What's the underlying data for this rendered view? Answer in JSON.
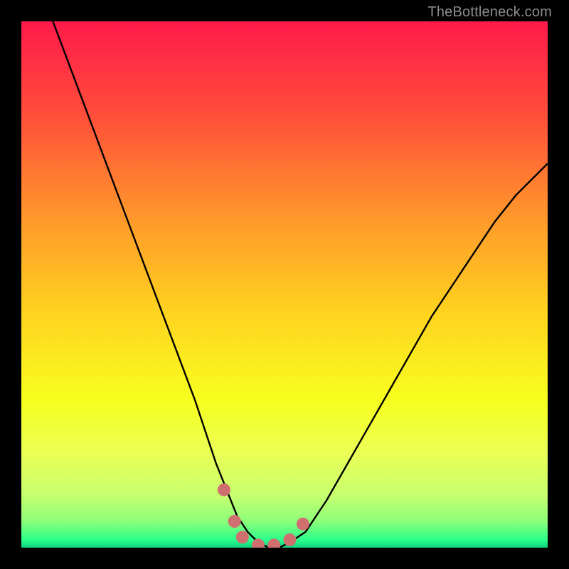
{
  "watermark": {
    "text": "TheBottleneck.com"
  },
  "chart_data": {
    "type": "line",
    "title": "",
    "xlabel": "",
    "ylabel": "",
    "xlim": [
      0,
      100
    ],
    "ylim": [
      0,
      100
    ],
    "grid": false,
    "note": "V-shaped bottleneck curve over vertical rainbow gradient. x approximates relative GPU/CPU balance (0–100); y approximates bottleneck percentage (0 = ideal, 100 = worst). Values estimated from pixel positions.",
    "background_gradient_stops": [
      {
        "offset": 0.0,
        "color": "#ff1a4b"
      },
      {
        "offset": 0.18,
        "color": "#ff4f3a"
      },
      {
        "offset": 0.38,
        "color": "#ff9a2a"
      },
      {
        "offset": 0.55,
        "color": "#ffd21f"
      },
      {
        "offset": 0.72,
        "color": "#f7ff1f"
      },
      {
        "offset": 0.82,
        "color": "#eaff55"
      },
      {
        "offset": 0.9,
        "color": "#c7ff6e"
      },
      {
        "offset": 0.95,
        "color": "#8dff7a"
      },
      {
        "offset": 0.985,
        "color": "#2bff8a"
      },
      {
        "offset": 1.0,
        "color": "#0bd47c"
      }
    ],
    "series": [
      {
        "name": "bottleneck-curve",
        "color": "#000000",
        "x": [
          6,
          9,
          12,
          15,
          18,
          21,
          24,
          27,
          30,
          33,
          35,
          37,
          39,
          41,
          43,
          45,
          47,
          49,
          51,
          54,
          58,
          62,
          66,
          70,
          74,
          78,
          82,
          86,
          90,
          94,
          98,
          100
        ],
        "y": [
          100,
          92,
          84,
          76,
          68,
          60,
          52,
          44,
          36,
          28,
          22,
          16,
          11,
          6,
          3,
          1,
          0,
          0,
          1,
          3,
          9,
          16,
          23,
          30,
          37,
          44,
          50,
          56,
          62,
          67,
          71,
          73
        ]
      }
    ],
    "markers": {
      "name": "optimal-zone-markers",
      "color": "#cf6f6f",
      "radius_px": 9,
      "points": [
        {
          "x": 38.5,
          "y": 11
        },
        {
          "x": 40.5,
          "y": 5
        },
        {
          "x": 42.0,
          "y": 2
        },
        {
          "x": 45.0,
          "y": 0.5
        },
        {
          "x": 48.0,
          "y": 0.5
        },
        {
          "x": 51.0,
          "y": 1.5
        },
        {
          "x": 53.5,
          "y": 4.5
        }
      ]
    }
  }
}
